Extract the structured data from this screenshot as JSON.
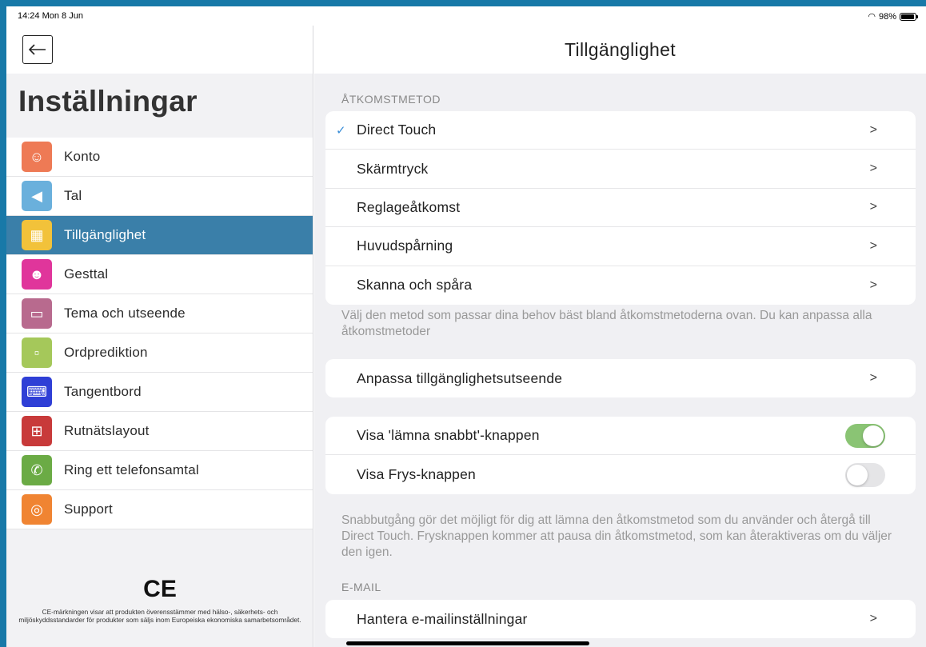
{
  "status_bar": {
    "time": "14:24",
    "date": "Mon 8 Jun",
    "battery": "98%"
  },
  "sidebar": {
    "title": "Inställningar",
    "items": [
      {
        "label": "Konto",
        "icon": "person-icon",
        "color": "#ee7a55",
        "glyph": "☺"
      },
      {
        "label": "Tal",
        "icon": "speaker-icon",
        "color": "#6ab0dc",
        "glyph": "◀"
      },
      {
        "label": "Tillgänglighet",
        "icon": "grid-hand-icon",
        "color": "#f2c23a",
        "glyph": "▦"
      },
      {
        "label": "Gesttal",
        "icon": "face-icon",
        "color": "#e0359b",
        "glyph": "☻"
      },
      {
        "label": "Tema och utseende",
        "icon": "theme-icon",
        "color": "#b86a8e",
        "glyph": "▭"
      },
      {
        "label": "Ordprediktion",
        "icon": "word-prediction-icon",
        "color": "#a5c85a",
        "glyph": "▫"
      },
      {
        "label": "Tangentbord",
        "icon": "keyboard-icon",
        "color": "#2f3fd6",
        "glyph": "⌨"
      },
      {
        "label": "Rutnätslayout",
        "icon": "grid-layout-icon",
        "color": "#c83a3a",
        "glyph": "⊞"
      },
      {
        "label": "Ring ett telefonsamtal",
        "icon": "phone-icon",
        "color": "#6bab45",
        "glyph": "✆"
      },
      {
        "label": "Support",
        "icon": "lifebuoy-icon",
        "color": "#f08432",
        "glyph": "◎"
      }
    ],
    "active_index": 2,
    "ce_mark": "CE",
    "ce_text": "CE-märkningen visar att produkten överensstämmer med hälso-, säkerhets- och miljöskyddsstandarder för produkter som säljs inom Europeiska ekonomiska samarbetsområdet."
  },
  "main": {
    "title": "Tillgänglighet",
    "access_section_label": "ÅTKOMSTMETOD",
    "access_methods": [
      {
        "label": "Direct Touch",
        "selected": true
      },
      {
        "label": "Skärmtryck",
        "selected": false
      },
      {
        "label": "Reglageåtkomst",
        "selected": false
      },
      {
        "label": "Huvudspårning",
        "selected": false
      },
      {
        "label": "Skanna och spåra",
        "selected": false
      }
    ],
    "access_note": "Välj den metod som passar dina behov bäst bland åtkomstmetoderna ovan. Du kan anpassa alla åtkomstmetoder",
    "customize_label": "Anpassa tillgänglighetsutseende",
    "toggles": [
      {
        "label": "Visa 'lämna snabbt'-knappen",
        "on": true
      },
      {
        "label": "Visa Frys-knappen",
        "on": false
      }
    ],
    "toggle_note": "Snabbutgång gör det möjligt för dig att lämna den åtkomstmetod som du använder och återgå till Direct Touch. Frysknappen kommer att pausa din åtkomstmetod, som kan återaktiveras om du väljer den igen.",
    "email_section_label": "E-MAIL",
    "email_label": "Hantera e-mailinställningar"
  },
  "colors": {
    "frame": "#1879a8",
    "active": "#3a7fa9",
    "toggle_on": "#8ac474",
    "check": "#3a8ed8"
  }
}
